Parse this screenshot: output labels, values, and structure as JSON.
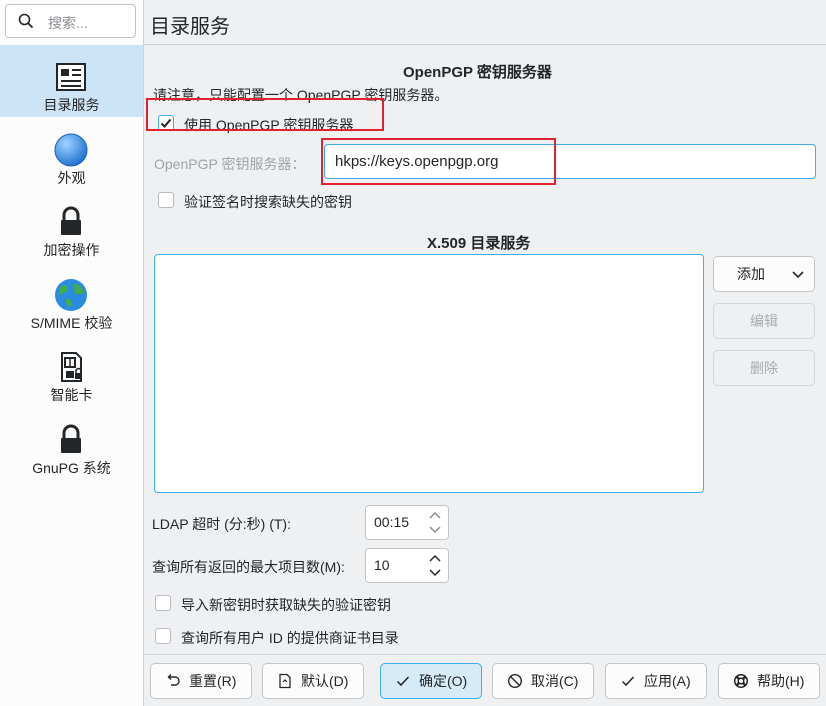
{
  "search": {
    "placeholder": "搜索..."
  },
  "sidebar": {
    "items": [
      {
        "label": "目录服务",
        "icon": "directory-services-icon",
        "active": true
      },
      {
        "label": "外观",
        "icon": "globe-appearance-icon"
      },
      {
        "label": "加密操作",
        "icon": "lock-icon"
      },
      {
        "label": "S/MIME 校验",
        "icon": "earth-icon"
      },
      {
        "label": "智能卡",
        "icon": "smartcard-icon"
      },
      {
        "label": "GnuPG 系统",
        "icon": "lock-icon"
      }
    ]
  },
  "page": {
    "title": "目录服务"
  },
  "openpgp": {
    "heading": "OpenPGP 密钥服务器",
    "note": "请注意，只能配置一个 OpenPGP 密钥服务器。",
    "use_label": "使用 OpenPGP 密钥服务器",
    "use_checked": true,
    "server_label": "OpenPGP 密钥服务器：",
    "server_value": "hkps://keys.openpgp.org",
    "verify_label": "验证签名时搜索缺失的密钥",
    "verify_checked": false
  },
  "x509": {
    "heading": "X.509 目录服务",
    "add_label": "添加",
    "edit_label": "编辑",
    "delete_label": "删除",
    "ldap_timeout_label": "LDAP 超时 (分:秒) (T):",
    "ldap_timeout_value": "00:15",
    "max_items_label": "查询所有返回的最大项目数(M):",
    "max_items_value": "10",
    "import_missing_label": "导入新密钥时获取缺失的验证密钥",
    "query_all_label": "查询所有用户 ID 的提供商证书目录"
  },
  "footer": {
    "reset": "重置(R)",
    "defaults": "默认(D)",
    "ok": "确定(O)",
    "cancel": "取消(C)",
    "apply": "应用(A)",
    "help": "帮助(H)"
  },
  "colors": {
    "accent": "#3daee9",
    "highlight_box": "#e0232d",
    "sidebar_active": "#cde3f6"
  }
}
